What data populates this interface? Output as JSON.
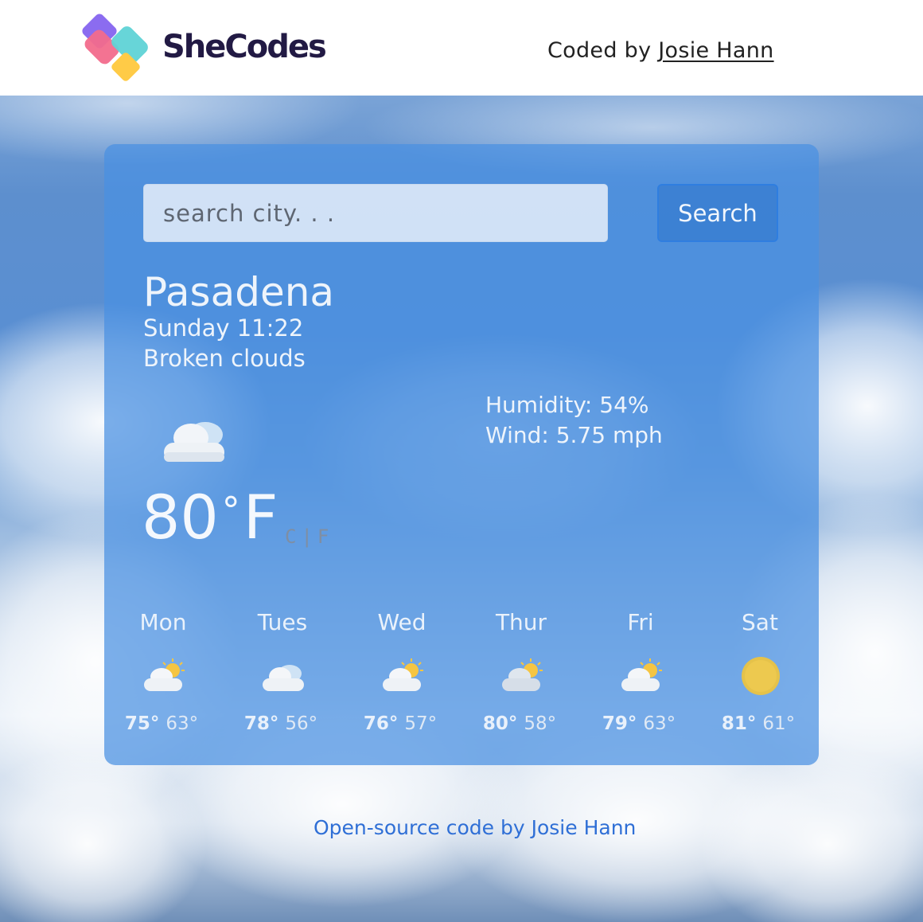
{
  "header": {
    "brand": "SheCodes",
    "credit_prefix": "Coded by",
    "credit_name": "Josie Hann"
  },
  "search": {
    "placeholder": "search city. . .",
    "button_label": "Search"
  },
  "current": {
    "city": "Pasadena",
    "datetime": "Sunday 11:22",
    "description": "Broken clouds",
    "humidity": "Humidity: 54%",
    "wind": "Wind: 5.75 mph",
    "temp_value": "80",
    "temp_degree": "°",
    "temp_unit": "F",
    "unit_c": "C",
    "unit_sep": "|",
    "unit_f": "F",
    "icon": "cloud-icon"
  },
  "forecast": [
    {
      "day": "Mon",
      "hi": "75°",
      "lo": "63°",
      "icon": "partly-cloudy-icon"
    },
    {
      "day": "Tues",
      "hi": "78°",
      "lo": "56°",
      "icon": "cloud-icon"
    },
    {
      "day": "Wed",
      "hi": "76°",
      "lo": "57°",
      "icon": "partly-cloudy-icon"
    },
    {
      "day": "Thur",
      "hi": "80°",
      "lo": "58°",
      "icon": "partly-cloudy-icon"
    },
    {
      "day": "Fri",
      "hi": "79°",
      "lo": "63°",
      "icon": "partly-cloudy-icon"
    },
    {
      "day": "Sat",
      "hi": "81°",
      "lo": "61°",
      "icon": "sun-icon"
    }
  ],
  "footer": {
    "link_text": "Open-source code by Josie Hann"
  },
  "colors": {
    "card": "#4a90e2",
    "brand_text": "#221a44",
    "footer_link": "#2f6fd6"
  }
}
